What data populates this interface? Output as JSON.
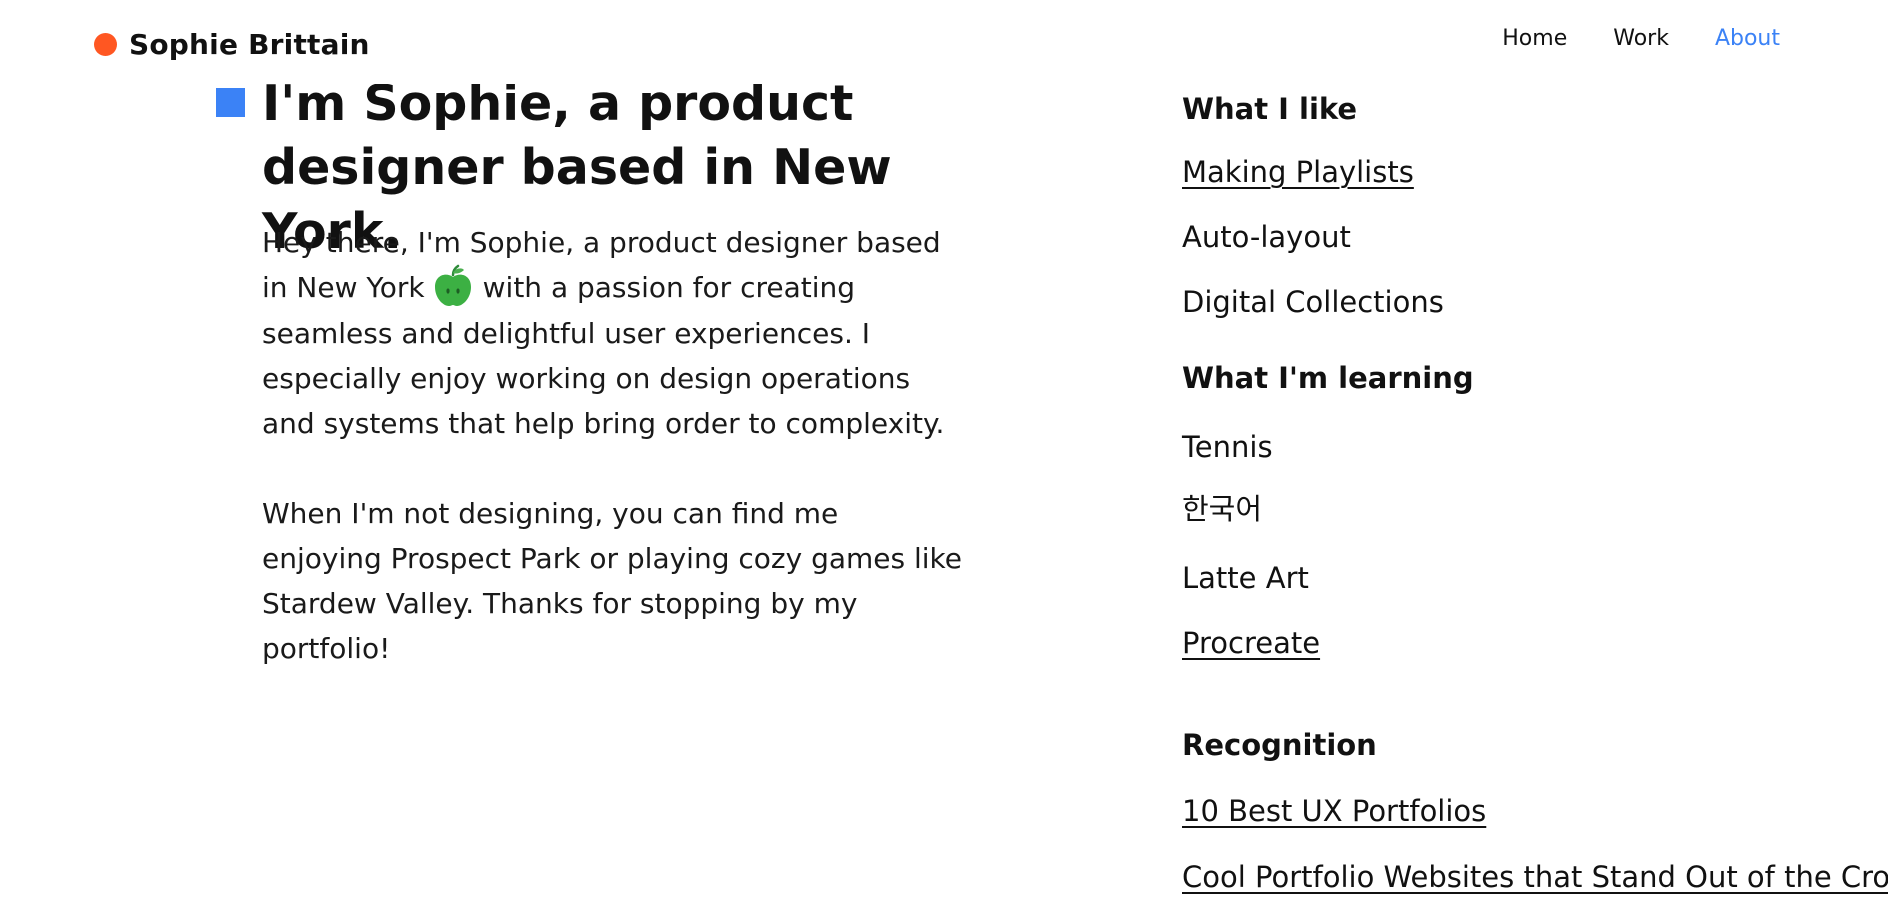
{
  "header": {
    "brand": "Sophie Brittain",
    "nav": [
      "Home",
      "Work",
      "About"
    ],
    "active_nav": "About"
  },
  "intro": {
    "title": "I'm Sophie, a product designer based in New York.",
    "p1_a": "Hey there, I'm Sophie, a product designer based in New York",
    "p1_b": "with a passion for creating seamless and delightful user experiences. I especially enjoy working on design operations and systems that help bring order to complexity.",
    "p2": "When I'm not designing, you can find me enjoying Prospect Park or playing cozy games like Stardew Valley. Thanks for stopping by my portfolio!",
    "emoji_icon": "green-apple-icon"
  },
  "likes": {
    "title": "What I like",
    "items": [
      "Making Playlists",
      "Auto-layout",
      "Digital Collections"
    ]
  },
  "learning": {
    "title": "What I'm learning",
    "items": [
      "Tennis",
      "한국어",
      "Latte Art",
      "Procreate"
    ]
  },
  "recognition": {
    "title": "Recognition",
    "items": [
      "10 Best UX Portfolios ",
      "Cool Portfolio Websites that Stand Out of the Crowd"
    ]
  },
  "colors": {
    "brand_dot": "#ff5722",
    "accent_blue": "#3b82f6",
    "apple_green": "#3cb043"
  }
}
